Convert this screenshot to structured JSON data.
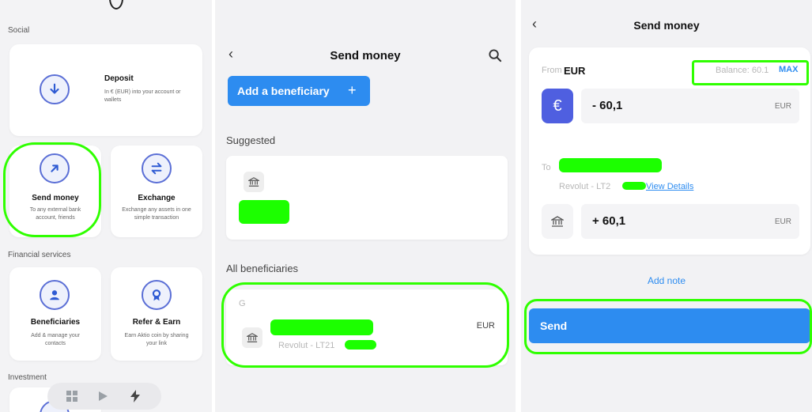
{
  "panel1": {
    "sections": {
      "social": "Social",
      "financial": "Financial services",
      "investment": "Investment"
    },
    "cards": [
      {
        "title": "Deposit",
        "desc": "In € (EUR) into your account or wallets",
        "icon": "arrow-down-icon"
      },
      {
        "title": "Send money",
        "desc": "To any external bank account, friends",
        "icon": "arrow-up-right-icon"
      },
      {
        "title": "Exchange",
        "desc": "Exchange any assets in one simple transaction",
        "icon": "swap-icon"
      },
      {
        "title": "Beneficiaries",
        "desc": "Add & manage your contacts",
        "icon": "user-icon"
      },
      {
        "title": "Refer & Earn",
        "desc": "Earn Aktio coin by sharing your link",
        "icon": "award-icon"
      }
    ],
    "nav_icons": [
      "grid-icon",
      "play-icon",
      "bolt-icon"
    ]
  },
  "panel2": {
    "title": "Send money",
    "add_beneficiary": "Add a beneficiary",
    "plus": "+",
    "suggested": "Suggested",
    "all_beneficiaries": "All beneficiaries",
    "group_letter": "G",
    "row_sub": "Revolut - LT21",
    "row_currency": "EUR"
  },
  "panel3": {
    "title": "Send money",
    "from_label": "From",
    "from_currency": "EUR",
    "balance": "Balance: 60.1",
    "max": "MAX",
    "from_amount": "- 60,1",
    "from_unit": "EUR",
    "currency_symbol": "€",
    "to_label": "To",
    "to_sub": "Revolut - LT2",
    "view_details": "View Details",
    "to_amount": "+ 60,1",
    "to_unit": "EUR",
    "add_note": "Add note",
    "send": "Send"
  },
  "colors": {
    "accent": "#2d8cf0",
    "highlight": "#2fff00",
    "icon_blue": "#5b6fd6"
  }
}
